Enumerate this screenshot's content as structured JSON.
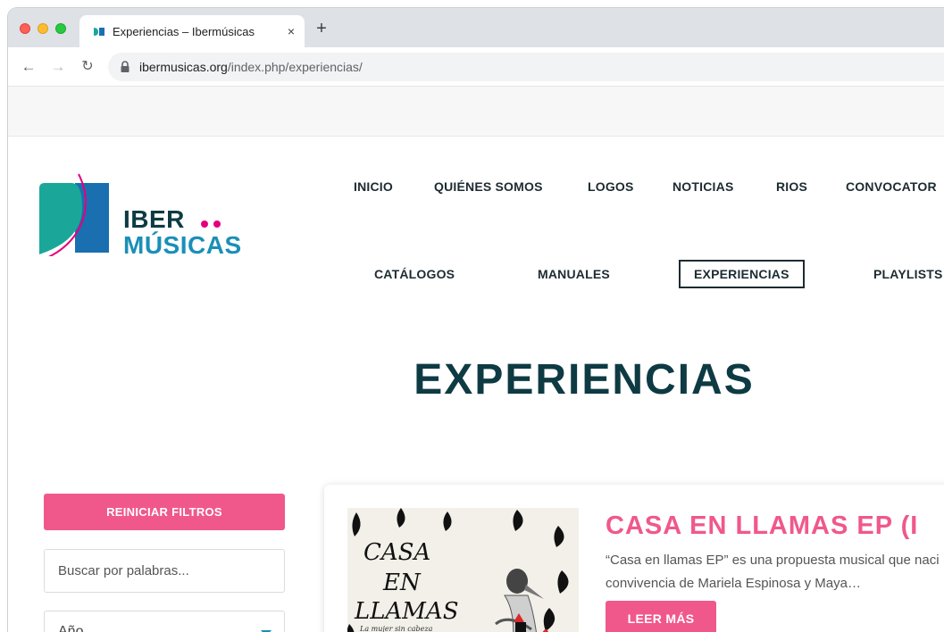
{
  "browser": {
    "tab_title": "Experiencias – Ibermúsicas",
    "tab_close": "×",
    "new_tab": "+",
    "url_host": "ibermusicas.org",
    "url_path": "/index.php/experiencias/"
  },
  "logo": {
    "line1": "IBER",
    "line2": "MÚSICAS",
    "colors": {
      "teal": "#1aa79a",
      "blue": "#1a6fb0",
      "magenta": "#e4007d"
    }
  },
  "nav": {
    "row1": [
      "INICIO",
      "QUIÉNES SOMOS",
      "LOGOS",
      "NOTICIAS",
      "RIOS",
      "CONVOCATOR"
    ],
    "row2": [
      "CATÁLOGOS",
      "MANUALES",
      "EXPERIENCIAS",
      "PLAYLISTS"
    ],
    "active": "EXPERIENCIAS"
  },
  "page": {
    "title": "EXPERIENCIAS"
  },
  "filters": {
    "reset_label": "REINICIAR FILTROS",
    "search_placeholder": "Buscar por palabras...",
    "year_label": "Año"
  },
  "card": {
    "title": "CASA EN LLAMAS EP (I",
    "description_line1": "“Casa en llamas EP” es una propuesta musical que naci",
    "description_line2": "convivencia de Mariela Espinosa y Maya…",
    "read_more": "LEER MÁS",
    "image_text": {
      "line1": "CASA",
      "line2": "EN",
      "line3": "LLAMAS",
      "subtitle": "La mujer sin cabeza"
    }
  },
  "colors": {
    "pink": "#f0588b",
    "dark_teal": "#0e3b43",
    "accent_blue": "#1a8fb8"
  }
}
